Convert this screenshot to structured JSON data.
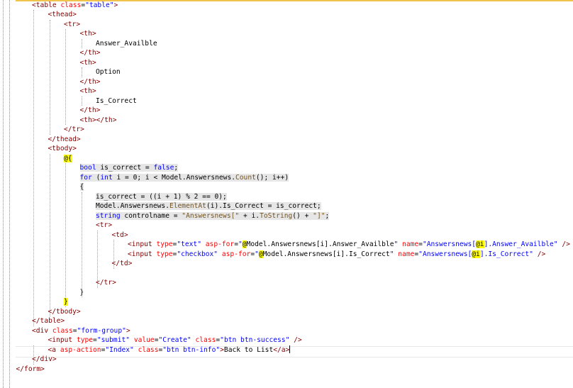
{
  "editor": {
    "language": "razor",
    "lines": [
      {
        "indent": 0,
        "highlight": false,
        "tokens": [
          [
            "t-tag",
            "<table "
          ],
          [
            "t-attr",
            "class"
          ],
          [
            "t-pun",
            "="
          ],
          [
            "t-str",
            "\"table\""
          ],
          [
            "t-tag",
            ">"
          ]
        ]
      },
      {
        "indent": 1,
        "highlight": false,
        "tokens": [
          [
            "t-tag",
            "<thead>"
          ]
        ]
      },
      {
        "indent": 2,
        "highlight": false,
        "tokens": [
          [
            "t-tag",
            "<tr>"
          ]
        ]
      },
      {
        "indent": 3,
        "highlight": false,
        "tokens": [
          [
            "t-tag",
            "<th>"
          ]
        ]
      },
      {
        "indent": 4,
        "highlight": false,
        "tokens": [
          [
            "t-txt",
            "Answer_Availble"
          ]
        ]
      },
      {
        "indent": 3,
        "highlight": false,
        "tokens": [
          [
            "t-tag",
            "</th>"
          ]
        ]
      },
      {
        "indent": 3,
        "highlight": false,
        "tokens": [
          [
            "t-tag",
            "<th>"
          ]
        ]
      },
      {
        "indent": 4,
        "highlight": false,
        "tokens": [
          [
            "t-txt",
            "Option"
          ]
        ]
      },
      {
        "indent": 3,
        "highlight": false,
        "tokens": [
          [
            "t-tag",
            "</th>"
          ]
        ]
      },
      {
        "indent": 3,
        "highlight": false,
        "tokens": [
          [
            "t-tag",
            "<th>"
          ]
        ]
      },
      {
        "indent": 4,
        "highlight": false,
        "tokens": [
          [
            "t-txt",
            "Is_Correct"
          ]
        ]
      },
      {
        "indent": 3,
        "highlight": false,
        "tokens": [
          [
            "t-tag",
            "</th>"
          ]
        ]
      },
      {
        "indent": 3,
        "highlight": false,
        "tokens": [
          [
            "t-tag",
            "<th></th>"
          ]
        ]
      },
      {
        "indent": 2,
        "highlight": false,
        "tokens": [
          [
            "t-tag",
            "</tr>"
          ]
        ]
      },
      {
        "indent": 1,
        "highlight": false,
        "tokens": [
          [
            "t-tag",
            "</thead>"
          ]
        ]
      },
      {
        "indent": 1,
        "highlight": false,
        "tokens": [
          [
            "t-tag",
            "<tbody>"
          ]
        ]
      },
      {
        "indent": 2,
        "highlight": false,
        "tokens": [
          [
            "t-raz",
            "@{"
          ]
        ]
      },
      {
        "indent": 3,
        "highlight": true,
        "tokens": [
          [
            "t-kw",
            "bool"
          ],
          [
            "t-txt",
            " is_correct = "
          ],
          [
            "t-kw",
            "false"
          ],
          [
            "t-txt",
            ";"
          ]
        ]
      },
      {
        "indent": 3,
        "highlight": true,
        "tokens": [
          [
            "t-kw",
            "for"
          ],
          [
            "t-txt",
            " ("
          ],
          [
            "t-kw",
            "int"
          ],
          [
            "t-txt",
            " i = 0; i < Model.Answersnews."
          ],
          [
            "t-meth",
            "Count"
          ],
          [
            "t-txt",
            "(); i++)"
          ]
        ]
      },
      {
        "indent": 3,
        "highlight": true,
        "tokens": [
          [
            "t-txt",
            "{"
          ]
        ]
      },
      {
        "indent": 4,
        "highlight": true,
        "tokens": [
          [
            "t-txt",
            "is_correct = ((i + 1) % 2 == 0);"
          ]
        ]
      },
      {
        "indent": 4,
        "highlight": true,
        "tokens": [
          [
            "t-txt",
            "Model.Answersnews."
          ],
          [
            "t-meth",
            "ElementAt"
          ],
          [
            "t-txt",
            "(i).Is_Correct = is_correct;"
          ]
        ]
      },
      {
        "indent": 4,
        "highlight": true,
        "tokens": [
          [
            "t-kw",
            "string"
          ],
          [
            "t-txt",
            " controlname = "
          ],
          [
            "t-meth",
            "\"Answersnews[\""
          ],
          [
            "t-txt",
            " + i."
          ],
          [
            "t-meth",
            "ToString"
          ],
          [
            "t-txt",
            "() + "
          ],
          [
            "t-meth",
            "\"]\""
          ],
          [
            "t-txt",
            ";"
          ]
        ]
      },
      {
        "indent": 4,
        "highlight": false,
        "tokens": [
          [
            "t-tag",
            "<tr>"
          ]
        ]
      },
      {
        "indent": 5,
        "highlight": false,
        "tokens": [
          [
            "t-tag",
            "<td>"
          ]
        ]
      },
      {
        "indent": 6,
        "highlight": false,
        "tokens": [
          [
            "t-tag",
            "<input "
          ],
          [
            "t-attr",
            "type"
          ],
          [
            "t-pun",
            "="
          ],
          [
            "t-str",
            "\"text\""
          ],
          [
            "t-tag",
            " "
          ],
          [
            "t-attr",
            "asp-for"
          ],
          [
            "t-pun",
            "="
          ],
          [
            "t-str",
            "\""
          ],
          [
            "t-raz",
            "@"
          ],
          [
            "t-txt",
            "Model.Answersnews[i].Answer_Availble"
          ],
          [
            "t-str",
            "\""
          ],
          [
            "t-tag",
            " "
          ],
          [
            "t-attr",
            "name"
          ],
          [
            "t-pun",
            "="
          ],
          [
            "t-str",
            "\"Answersnews["
          ],
          [
            "t-raz",
            "@i"
          ],
          [
            "t-str",
            "].Answer_Availble\""
          ],
          [
            "t-tag",
            " />"
          ]
        ]
      },
      {
        "indent": 6,
        "highlight": false,
        "tokens": [
          [
            "t-tag",
            "<input "
          ],
          [
            "t-attr",
            "type"
          ],
          [
            "t-pun",
            "="
          ],
          [
            "t-str",
            "\"checkbox\""
          ],
          [
            "t-tag",
            " "
          ],
          [
            "t-attr",
            "asp-for"
          ],
          [
            "t-pun",
            "="
          ],
          [
            "t-str",
            "\""
          ],
          [
            "t-raz",
            "@"
          ],
          [
            "t-txt",
            "Model.Answersnews[i].Is_Correct"
          ],
          [
            "t-str",
            "\""
          ],
          [
            "t-tag",
            " "
          ],
          [
            "t-attr",
            "name"
          ],
          [
            "t-pun",
            "="
          ],
          [
            "t-str",
            "\"Answersnews["
          ],
          [
            "t-raz",
            "@i"
          ],
          [
            "t-str",
            "].Is_Correct\""
          ],
          [
            "t-tag",
            " />"
          ]
        ]
      },
      {
        "indent": 5,
        "highlight": false,
        "tokens": [
          [
            "t-tag",
            "</td>"
          ]
        ]
      },
      {
        "indent": 4,
        "highlight": false,
        "tokens": []
      },
      {
        "indent": 4,
        "highlight": false,
        "tokens": [
          [
            "t-tag",
            "</tr>"
          ]
        ]
      },
      {
        "indent": 3,
        "highlight": false,
        "tokens": [
          [
            "t-txt",
            "}"
          ]
        ]
      },
      {
        "indent": 2,
        "highlight": false,
        "tokens": [
          [
            "t-raz",
            "}"
          ]
        ]
      },
      {
        "indent": 1,
        "highlight": false,
        "tokens": [
          [
            "t-tag",
            "</tbody>"
          ]
        ]
      },
      {
        "indent": 0,
        "highlight": false,
        "tokens": [
          [
            "t-tag",
            "</table>"
          ]
        ]
      },
      {
        "indent": 0,
        "highlight": false,
        "tokens": [
          [
            "t-tag",
            "<div "
          ],
          [
            "t-attr",
            "class"
          ],
          [
            "t-pun",
            "="
          ],
          [
            "t-str",
            "\"form-group\""
          ],
          [
            "t-tag",
            ">"
          ]
        ]
      },
      {
        "indent": 1,
        "highlight": false,
        "tokens": [
          [
            "t-tag",
            "<input "
          ],
          [
            "t-attr",
            "type"
          ],
          [
            "t-pun",
            "="
          ],
          [
            "t-str",
            "\"submit\""
          ],
          [
            "t-tag",
            " "
          ],
          [
            "t-attr",
            "value"
          ],
          [
            "t-pun",
            "="
          ],
          [
            "t-str",
            "\"Create\""
          ],
          [
            "t-tag",
            " "
          ],
          [
            "t-attr",
            "class"
          ],
          [
            "t-pun",
            "="
          ],
          [
            "t-str",
            "\"btn btn-success\""
          ],
          [
            "t-tag",
            " />"
          ]
        ]
      },
      {
        "indent": 1,
        "highlight": false,
        "caret": true,
        "tokens": [
          [
            "t-tag",
            "<a "
          ],
          [
            "t-attr",
            "asp-action"
          ],
          [
            "t-pun",
            "="
          ],
          [
            "t-str",
            "\"Index\""
          ],
          [
            "t-tag",
            " "
          ],
          [
            "t-attr",
            "class"
          ],
          [
            "t-pun",
            "="
          ],
          [
            "t-str",
            "\"btn btn-info\""
          ],
          [
            "t-tag",
            ">"
          ],
          [
            "t-txt",
            "Back to List"
          ],
          [
            "t-tag",
            "</a>"
          ]
        ]
      },
      {
        "indent": 0,
        "highlight": false,
        "tokens": [
          [
            "t-tag",
            "</div>"
          ]
        ]
      },
      {
        "indent": -1,
        "highlight": false,
        "tokens": [
          [
            "t-tag",
            "</form>"
          ]
        ]
      }
    ]
  }
}
